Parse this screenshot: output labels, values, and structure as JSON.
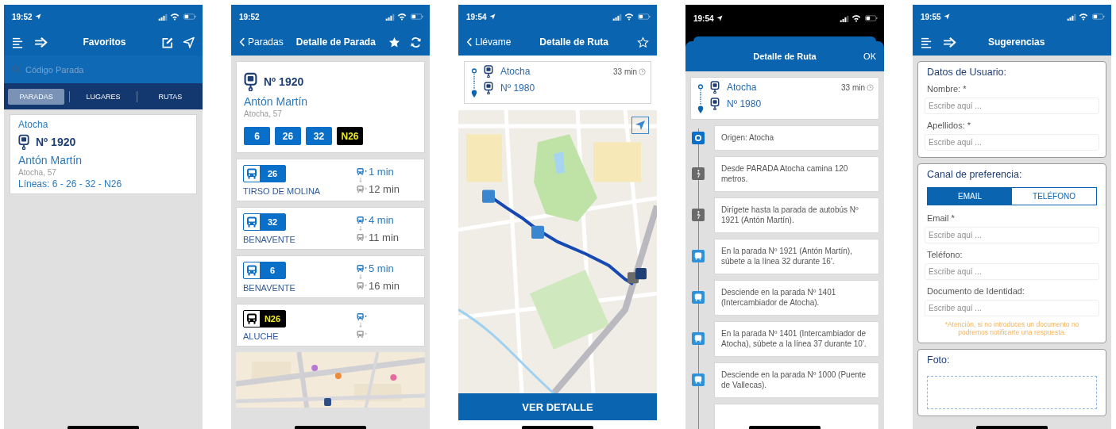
{
  "screens": [
    {
      "kind": "favorites",
      "status_bar": {
        "time": "19:52",
        "location": true,
        "dark": false
      },
      "title": "Favoritos",
      "search": {
        "placeholder": "Código Parada"
      },
      "tabs": [
        {
          "label": "PARADAS",
          "selected": true
        },
        {
          "label": "LUGARES",
          "selected": false
        },
        {
          "label": "RUTAS",
          "selected": false
        }
      ],
      "favorites": [
        {
          "place": "Atocha",
          "stop_number": "Nº 1920",
          "stop_name": "Antón Martín",
          "address": "Atocha, 57",
          "lines": "Líneas: 6 -  26 -  32 -  N26"
        }
      ]
    },
    {
      "kind": "stop_detail",
      "status_bar": {
        "time": "19:52",
        "location": false,
        "dark": false
      },
      "back": "Paradas",
      "title": "Detalle de Parada",
      "favorite": true,
      "stop": {
        "stop_number": "Nº 1920",
        "stop_name": "Antón Martín",
        "address": "Atocha, 57",
        "lines": [
          {
            "label": "6",
            "night": false
          },
          {
            "label": "26",
            "night": false
          },
          {
            "label": "32",
            "night": false
          },
          {
            "label": "N26",
            "night": true
          }
        ]
      },
      "arrivals": [
        {
          "line": "26",
          "night": false,
          "destination": "TIRSO DE MOLINA",
          "next": "1 min",
          "following": "12 min"
        },
        {
          "line": "32",
          "night": false,
          "destination": "BENAVENTE",
          "next": "4 min",
          "following": "11 min"
        },
        {
          "line": "6",
          "night": false,
          "destination": "BENAVENTE",
          "next": "5 min",
          "following": "16 min"
        },
        {
          "line": "N26",
          "night": true,
          "destination": "ALUCHE"
        }
      ],
      "map": {
        "kind": "picture"
      }
    },
    {
      "kind": "route_map",
      "status_bar": {
        "time": "19:54",
        "location": true,
        "dark": false
      },
      "back": "Llévame",
      "title": "Detalle de Ruta",
      "favorite": false,
      "route": {
        "origin": "Atocha",
        "destination": "Nº 1980",
        "duration": "33 min"
      },
      "map": {
        "kind": "picture"
      },
      "button": "VER DETALLE"
    },
    {
      "kind": "route_detail",
      "status_bar": {
        "time": "19:54",
        "location": true,
        "dark": true
      },
      "title": "Detalle de Ruta",
      "done": "OK",
      "route": {
        "origin": "Atocha",
        "destination": "Nº 1980",
        "duration": "33 min"
      },
      "steps": [
        {
          "kind": "origin",
          "text": "Origen: Atocha"
        },
        {
          "kind": "walk",
          "text": "Desde PARADA Atocha camina 120 metros."
        },
        {
          "kind": "walk",
          "text": "Dirígete hasta la parada de autobús Nº 1921 (Antón Martín)."
        },
        {
          "kind": "bus",
          "text": "En la parada Nº 1921 (Antón Martín), súbete a la línea 32 durante 16'."
        },
        {
          "kind": "bus",
          "text": "Desciende en la parada Nº 1401 (Intercambiador de Atocha)."
        },
        {
          "kind": "bus",
          "text": "En la parada Nº 1401 (Intercambiador de Atocha), súbete a la línea 37 durante 10'."
        },
        {
          "kind": "bus",
          "text": "Desciende en la parada Nº 1000 (Puente de Vallecas)."
        }
      ]
    },
    {
      "kind": "suggestions",
      "status_bar": {
        "time": "19:55",
        "location": true,
        "dark": false
      },
      "title": "Sugerencias",
      "sections": [
        {
          "title": "Datos de Usuario:",
          "fields": [
            {
              "label": "Nombre: *",
              "placeholder": "Escribe aquí ..."
            },
            {
              "label": "Apellidos: *",
              "placeholder": "Escribe aquí ..."
            }
          ]
        },
        {
          "title": "Canal de preferencia:",
          "channels": [
            {
              "label": "EMAIL",
              "selected": true
            },
            {
              "label": "TELÉFONO",
              "selected": false
            }
          ],
          "fields": [
            {
              "label": "Email *",
              "placeholder": "Escribe aquí ..."
            },
            {
              "label": "Teléfono:",
              "placeholder": "Escribe aquí ..."
            },
            {
              "label": "Documento de Identidad:",
              "placeholder": "Escribe aquí ..."
            }
          ],
          "note": "*Atención, si no introduces un documento no podremos notificarte una respuesta."
        },
        {
          "title": "Foto:",
          "photo_drop": true
        }
      ]
    }
  ]
}
